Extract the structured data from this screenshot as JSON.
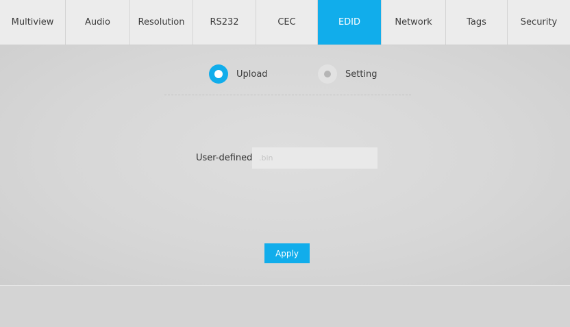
{
  "tabs": [
    {
      "label": "Multiview",
      "active": false
    },
    {
      "label": "Audio",
      "active": false
    },
    {
      "label": "Resolution",
      "active": false
    },
    {
      "label": "RS232",
      "active": false
    },
    {
      "label": "CEC",
      "active": false
    },
    {
      "label": "EDID",
      "active": true
    },
    {
      "label": "Network",
      "active": false
    },
    {
      "label": "Tags",
      "active": false
    },
    {
      "label": "Security",
      "active": false
    }
  ],
  "mode": {
    "options": [
      {
        "label": "Upload",
        "selected": true
      },
      {
        "label": "Setting",
        "selected": false
      }
    ]
  },
  "form": {
    "user_defined_label": "User-defined:",
    "user_defined_value": "",
    "user_defined_placeholder": ".bin"
  },
  "apply_label": "Apply",
  "colors": {
    "accent": "#11adeb",
    "tab_bar": "#ececec",
    "background": "#d8d8d8"
  }
}
